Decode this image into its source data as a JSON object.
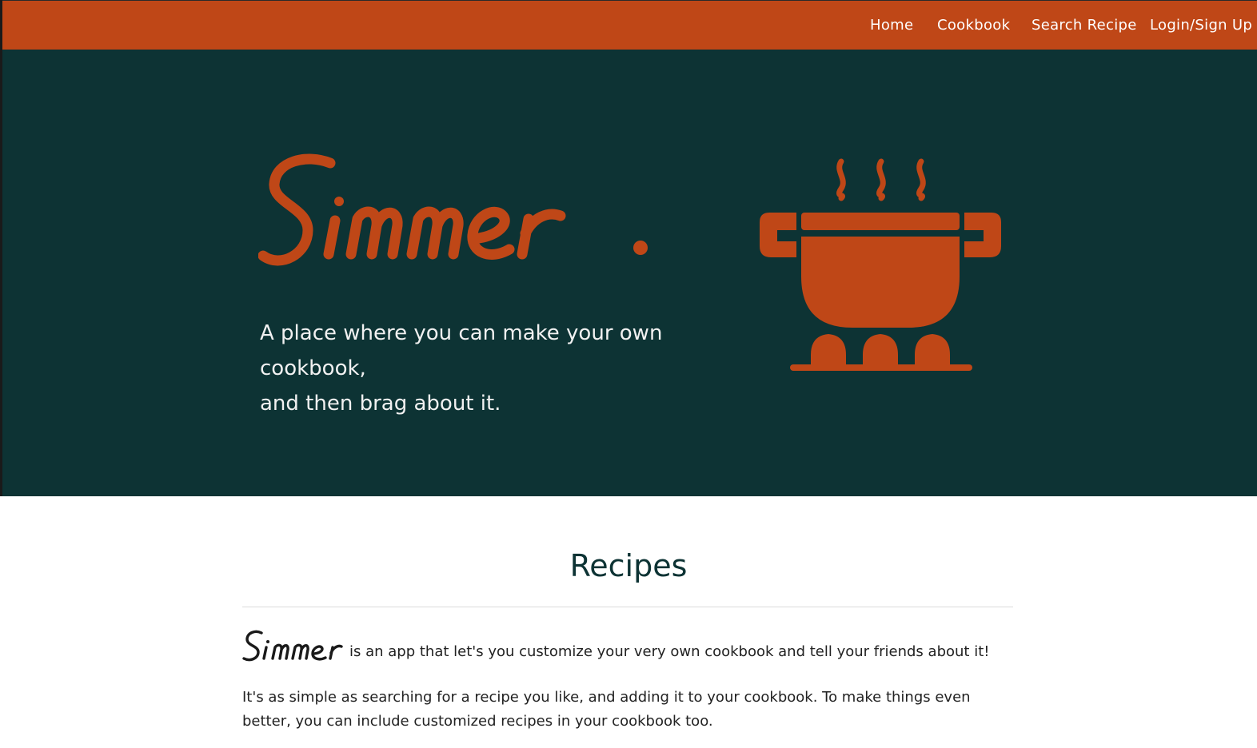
{
  "nav": {
    "links": [
      "Home",
      "Cookbook",
      "Search Recipe",
      "Login/Sign Up"
    ]
  },
  "hero": {
    "logo_text": "Simmer.",
    "tagline_line1": "A place where you can make your own cookbook,",
    "tagline_line2": "and then brag about it.",
    "icon": "cooking-pot-icon"
  },
  "recipes": {
    "title": "Recipes",
    "brand": "Simmer",
    "intro": "is an app that let's you customize your very own cookbook and tell your friends about it!",
    "paragraph": "It's as simple as searching for a recipe you like, and adding it to your cookbook. To make things even better, you can include customized recipes in your cookbook too."
  },
  "colors": {
    "accent": "#bf4717",
    "hero_bg": "#0d3334",
    "text": "#222222"
  }
}
